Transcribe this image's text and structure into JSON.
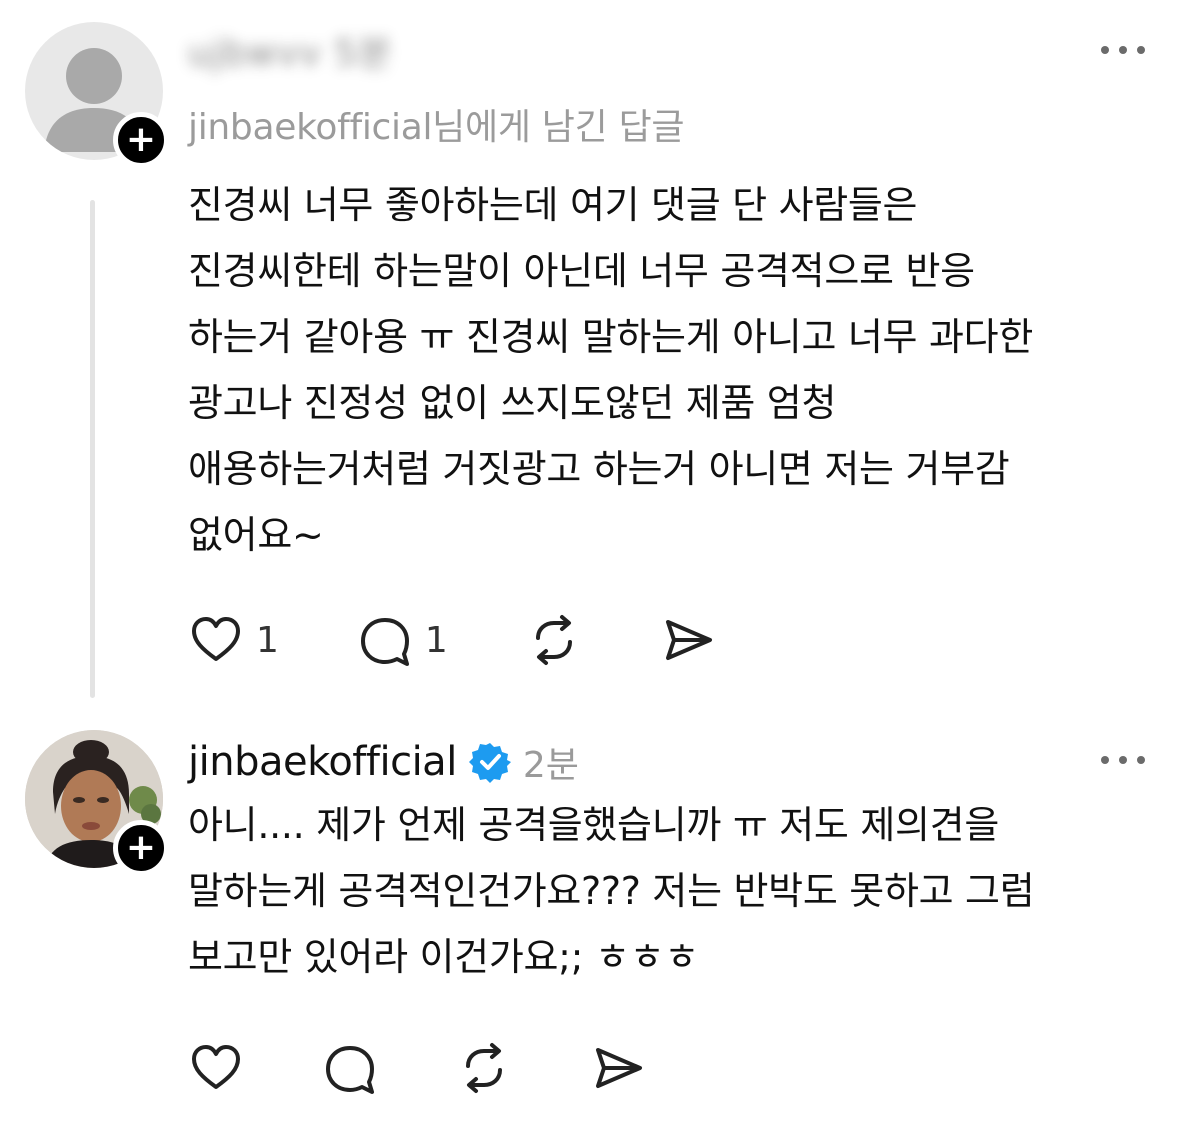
{
  "posts": [
    {
      "username_obscured": "ujbwvv 5분",
      "reply_to": "jinbaekofficial님에게 남긴 답글",
      "body_lines": [
        "진경씨 너무 좋아하는데 여기 댓글 단 사람들은",
        "진경씨한테 하는말이 아닌데 너무 공격적으로 반응",
        "하는거 같아용 ㅠ 진경씨 말하는게 아니고 너무 과다한",
        "광고나 진정성 없이 쓰지도않던 제품 엄청",
        "애용하는거처럼 거짓광고 하는거 아니면 저는 거부감",
        "없어요~"
      ],
      "likes": "1",
      "comments": "1",
      "follow_label": "+"
    },
    {
      "username": "jinbaekofficial",
      "time": "2분",
      "body_lines": [
        "아니.... 제가 언제 공격을했습니까 ㅠ 저도 제의견을",
        "말하는게 공격적인건가요??? 저는 반박도 못하고 그럼",
        "보고만 있어라 이건가요;; ㅎㅎㅎ"
      ],
      "follow_label": "+"
    }
  ],
  "icons": {
    "like": "heart-icon",
    "comment": "comment-bubble-icon",
    "repost": "repost-arrows-icon",
    "share": "send-paper-plane-icon",
    "more": "more-dots-icon",
    "verified": "verified-badge-icon"
  },
  "colors": {
    "text": "#111111",
    "muted": "#9a9a9a",
    "verified": "#1d9bf0",
    "thread_line": "#e3e3e3"
  }
}
